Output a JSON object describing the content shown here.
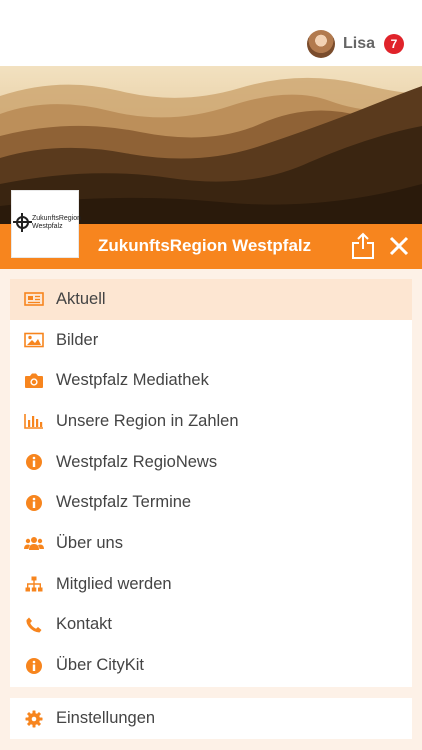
{
  "header": {
    "user_name": "Lisa",
    "notification_count": "7"
  },
  "logo": {
    "line1": "ZukunftsRegion",
    "line2": "Westpfalz"
  },
  "titlebar": {
    "title": "ZukunftsRegion Westpfalz"
  },
  "menu": {
    "items": [
      {
        "label": "Aktuell",
        "icon": "newspaper-icon",
        "active": true
      },
      {
        "label": "Bilder",
        "icon": "image-icon",
        "active": false
      },
      {
        "label": "Westpfalz Mediathek",
        "icon": "camera-icon",
        "active": false
      },
      {
        "label": "Unsere Region in Zahlen",
        "icon": "bar-chart-icon",
        "active": false
      },
      {
        "label": "Westpfalz RegioNews",
        "icon": "info-icon",
        "active": false
      },
      {
        "label": "Westpfalz Termine",
        "icon": "info-icon",
        "active": false
      },
      {
        "label": "Über uns",
        "icon": "users-icon",
        "active": false
      },
      {
        "label": "Mitglied werden",
        "icon": "sitemap-icon",
        "active": false
      },
      {
        "label": "Kontakt",
        "icon": "phone-icon",
        "active": false
      },
      {
        "label": "Über CityKit",
        "icon": "info-icon",
        "active": false
      }
    ],
    "settings_label": "Einstellungen"
  },
  "colors": {
    "accent": "#f7851e",
    "active_bg": "#fde6d2",
    "badge": "#e0232a",
    "page_bg": "#fdf1e7"
  }
}
